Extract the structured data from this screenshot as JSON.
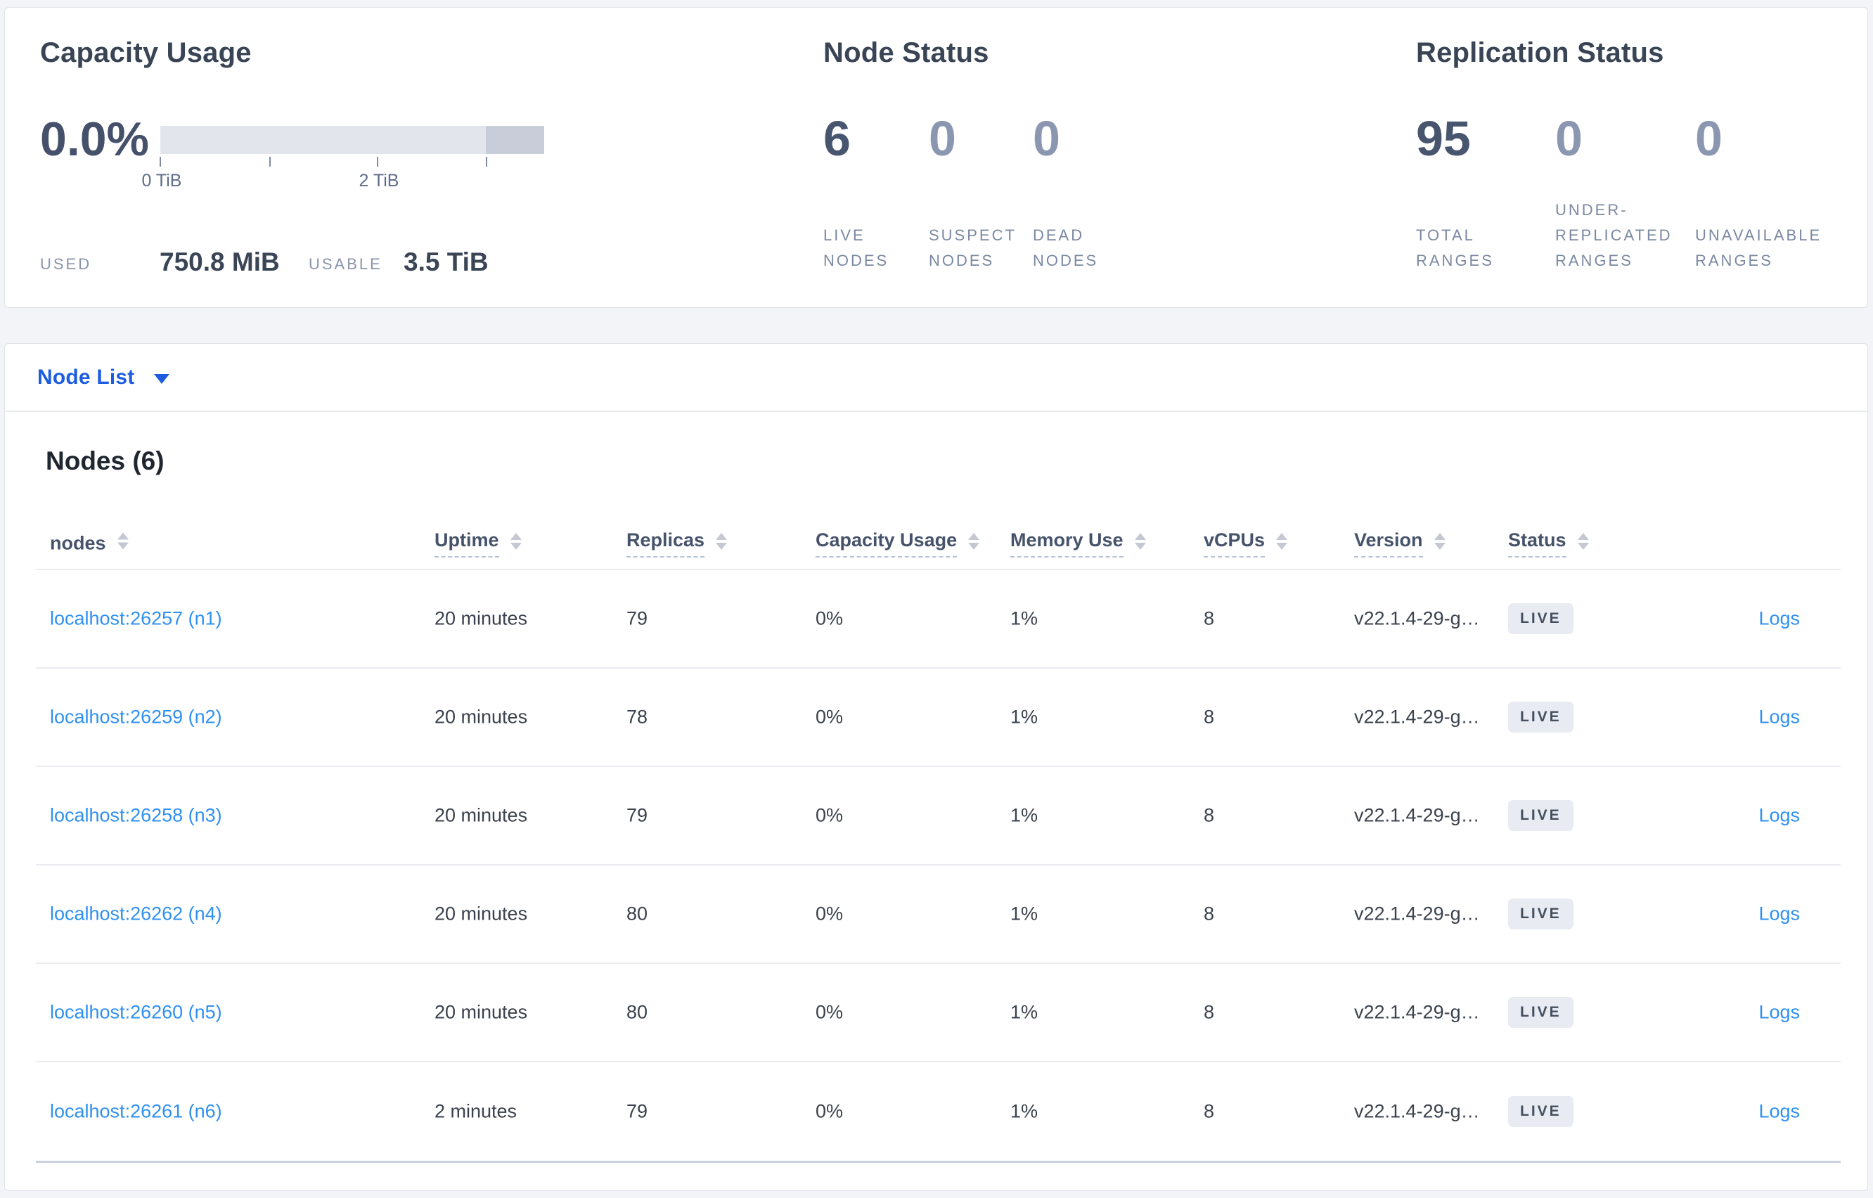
{
  "summary": {
    "capacity": {
      "title": "Capacity Usage",
      "percent": "0.0%",
      "ticks": [
        "0 TiB",
        "2 TiB"
      ],
      "used_label": "USED",
      "used_value": "750.8 MiB",
      "usable_label": "USABLE",
      "usable_value": "3.5 TiB"
    },
    "node_status": {
      "title": "Node Status",
      "stats": [
        {
          "value": "6",
          "label": "LIVE NODES"
        },
        {
          "value": "0",
          "label": "SUSPECT NODES"
        },
        {
          "value": "0",
          "label": "DEAD NODES"
        }
      ]
    },
    "replication": {
      "title": "Replication Status",
      "stats": [
        {
          "value": "95",
          "label": "TOTAL RANGES"
        },
        {
          "value": "0",
          "label": "UNDER-REPLICATED RANGES"
        },
        {
          "value": "0",
          "label": "UNAVAILABLE RANGES"
        }
      ]
    }
  },
  "node_list": {
    "label": "Node List"
  },
  "nodes": {
    "heading": "Nodes (6)",
    "columns": {
      "nodes": "nodes",
      "uptime": "Uptime",
      "replicas": "Replicas",
      "capacity": "Capacity Usage",
      "memory": "Memory Use",
      "vcpus": "vCPUs",
      "version": "Version",
      "status": "Status"
    },
    "rows": [
      {
        "name": "localhost:26257 (n1)",
        "uptime": "20 minutes",
        "replicas": "79",
        "capacity": "0%",
        "memory": "1%",
        "vcpus": "8",
        "version": "v22.1.4-29-g…",
        "status": "LIVE",
        "logs": "Logs"
      },
      {
        "name": "localhost:26259 (n2)",
        "uptime": "20 minutes",
        "replicas": "78",
        "capacity": "0%",
        "memory": "1%",
        "vcpus": "8",
        "version": "v22.1.4-29-g…",
        "status": "LIVE",
        "logs": "Logs"
      },
      {
        "name": "localhost:26258 (n3)",
        "uptime": "20 minutes",
        "replicas": "79",
        "capacity": "0%",
        "memory": "1%",
        "vcpus": "8",
        "version": "v22.1.4-29-g…",
        "status": "LIVE",
        "logs": "Logs"
      },
      {
        "name": "localhost:26262 (n4)",
        "uptime": "20 minutes",
        "replicas": "80",
        "capacity": "0%",
        "memory": "1%",
        "vcpus": "8",
        "version": "v22.1.4-29-g…",
        "status": "LIVE",
        "logs": "Logs"
      },
      {
        "name": "localhost:26260 (n5)",
        "uptime": "20 minutes",
        "replicas": "80",
        "capacity": "0%",
        "memory": "1%",
        "vcpus": "8",
        "version": "v22.1.4-29-g…",
        "status": "LIVE",
        "logs": "Logs"
      },
      {
        "name": "localhost:26261 (n6)",
        "uptime": "2 minutes",
        "replicas": "79",
        "capacity": "0%",
        "memory": "1%",
        "vcpus": "8",
        "version": "v22.1.4-29-g…",
        "status": "LIVE",
        "logs": "Logs"
      }
    ]
  },
  "colors": {
    "accent_blue": "#1d5cdf",
    "link_blue": "#2e90f2",
    "badge_bg": "#e9ebf2",
    "bar_light": "#e3e5ec",
    "bar_dark": "#c9cdd9"
  }
}
